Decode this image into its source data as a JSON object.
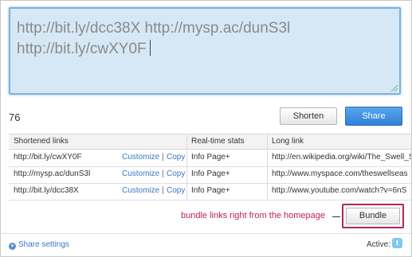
{
  "composer": {
    "line1": "http://bit.ly/dcc38X http://mysp.ac/dunS3l",
    "line2": "http://bit.ly/cwXY0F"
  },
  "char_counter": "76",
  "buttons": {
    "shorten": "Shorten",
    "share": "Share",
    "bundle": "Bundle"
  },
  "table": {
    "headers": [
      "Shortened links",
      "Real-time stats",
      "Long link"
    ],
    "rows": [
      {
        "short": "http://bit.ly/cwXY0F",
        "customize": "Customize",
        "sep": "|",
        "copy": "Copy",
        "stats": "Info Page+",
        "long": "http://en.wikipedia.org/wiki/The_Swell_S"
      },
      {
        "short": "http://mysp.ac/dunS3l",
        "customize": "Customize",
        "sep": "|",
        "copy": "Copy",
        "stats": "Info Page+",
        "long": "http://www.myspace.com/theswellseas"
      },
      {
        "short": "http://bit.ly/dcc38X",
        "customize": "Customize",
        "sep": "|",
        "copy": "Copy",
        "stats": "Info Page+",
        "long": "http://www.youtube.com/watch?v=6nS"
      }
    ]
  },
  "annotation": "bundle links right from the homepage",
  "footer": {
    "share_settings": "Share settings",
    "active_label": "Active:",
    "twitter_glyph": "t"
  },
  "colors": {
    "accent_blue": "#3a78c3",
    "share_button": "#2f7fd8",
    "annotation": "#c01e5c",
    "composer_bg": "#d6e8f5"
  },
  "icons": {
    "settings": "share-settings-icon",
    "network": "twitter-icon"
  }
}
